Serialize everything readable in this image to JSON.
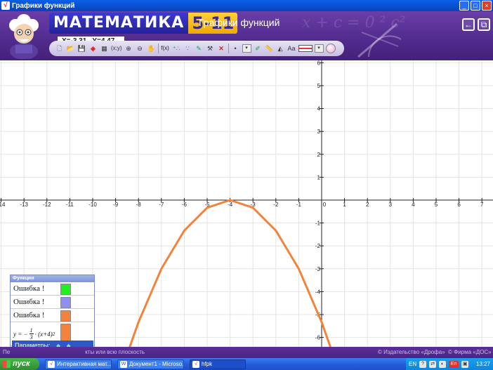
{
  "window": {
    "title": "Графики функций",
    "buttons": [
      "_",
      "□",
      "×"
    ]
  },
  "header": {
    "logo_text": "МАТЕМАТИКА",
    "logo_num": "5-11",
    "x_readout": "X=-3,31",
    "y_readout": "Y=4,47",
    "app_title": "Графики функций",
    "back_label": "←",
    "window_label": "⧉",
    "bg_formula": "x + c = 0   ²   c²"
  },
  "toolbar": {
    "items": [
      "new-icon",
      "open-icon",
      "save-icon",
      "eraser-icon",
      "grid-icon",
      "xy-icon",
      "zoom-in-icon",
      "zoom-out-icon",
      "hand-icon",
      "fx-icon",
      "points-icon",
      "dots-icon",
      "pencil-icon",
      "tool-icon",
      "delete-icon",
      "point-style-icon",
      "brush-icon",
      "ruler-icon",
      "triangle-icon",
      "text-icon",
      "color-icon",
      "palette-icon"
    ],
    "xy_label": "(x;y)",
    "fx_label": "f(x)",
    "text_label": "Aa",
    "delete_label": "✕"
  },
  "graph": {
    "x_ticks": [
      "-14",
      "-13",
      "-12",
      "-11",
      "-10",
      "-9",
      "-8",
      "-7",
      "-6",
      "-5",
      "-4",
      "-3",
      "-2",
      "-1",
      "0",
      "1",
      "2",
      "3",
      "4",
      "5",
      "6",
      "7"
    ],
    "y_ticks": [
      "6",
      "5",
      "4",
      "3",
      "2",
      "1",
      "-1",
      "-2",
      "-3",
      "-4",
      "-5",
      "-6"
    ],
    "curve_color": "#f5823a",
    "grid_color": "#e4e4e4"
  },
  "chart_data": {
    "type": "line",
    "xlim": [
      -14.2,
      7.2
    ],
    "ylim": [
      -6.6,
      6.2
    ],
    "grid": true,
    "series": [
      {
        "function": "y = -1/3 * (x + 4)^2",
        "color": "#f5823a",
        "x": [
          -8.5,
          -8,
          -7,
          -6,
          -5,
          -4,
          -3,
          -2,
          -1,
          0,
          0.5
        ],
        "y": [
          -6.75,
          -5.33,
          -3,
          -1.33,
          -0.33,
          0,
          -0.33,
          -1.33,
          -3,
          -5.33,
          -6.75
        ]
      }
    ]
  },
  "functions_panel": {
    "title": "Функции",
    "rows": [
      {
        "label": "Ошибка !",
        "color": "#22ee22"
      },
      {
        "label": "Ошибка !",
        "color": "#8f8ff0"
      },
      {
        "label": "Ошибка !",
        "color": "#f5823a"
      }
    ],
    "formula": {
      "lead": "y = −",
      "num": "1",
      "den": "3",
      "rest": "· (x+4)",
      "exp": "2",
      "color": "#f5823a"
    },
    "params_label": "Параметры:"
  },
  "status": {
    "hint": "Пе",
    "hint2": "кты или всю плоскость",
    "copyright1": "© Издательство «Дрофа»",
    "copyright2": "© Фирма «ДОС»"
  },
  "taskbar": {
    "start_label": "пуск",
    "tasks": [
      "Интерактивная мат...",
      "Документ1 - Microso...",
      "hfpk"
    ],
    "lang": "EN",
    "lang2": "En",
    "clock": "13:27"
  }
}
